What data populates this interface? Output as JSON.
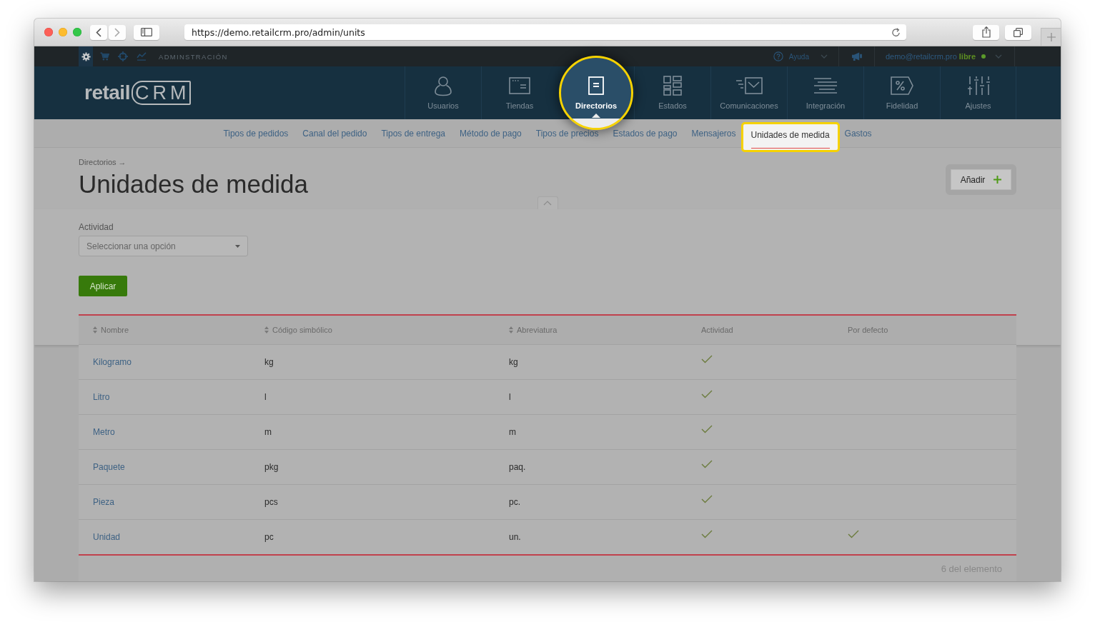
{
  "browser": {
    "url": "https://demo.retailcrm.pro/admin/units"
  },
  "admin_bar": {
    "tools": [
      {
        "selected": true
      },
      {
        "selected": false
      },
      {
        "selected": false
      },
      {
        "selected": false
      }
    ],
    "section": "ADMINSTRACIÓN",
    "help": "Ayuda",
    "user_email": "demo@retailcrm.pro",
    "plan": "libre"
  },
  "nav": {
    "logo": {
      "brand": "retail",
      "product": "CRM"
    },
    "items": [
      {
        "label": "Usuarios",
        "selected": false
      },
      {
        "label": "Tiendas",
        "selected": false
      },
      {
        "label": "Directorios",
        "selected": true
      },
      {
        "label": "Estados",
        "selected": false
      },
      {
        "label": "Comunicaciones",
        "selected": false
      },
      {
        "label": "Integración",
        "selected": false
      },
      {
        "label": "Fidelidad",
        "selected": false
      },
      {
        "label": "Ajustes",
        "selected": false
      }
    ]
  },
  "subnav": {
    "items": [
      {
        "label": "Tipos de pedidos",
        "selected": false
      },
      {
        "label": "Canal del pedido",
        "selected": false
      },
      {
        "label": "Tipos de entrega",
        "selected": false
      },
      {
        "label": "Método de pago",
        "selected": false
      },
      {
        "label": "Tipos de precios",
        "selected": false
      },
      {
        "label": "Estados de pago",
        "selected": false
      },
      {
        "label": "Mensajeros",
        "selected": false
      },
      {
        "label": "Unidades de medida",
        "selected": true
      },
      {
        "label": "Gastos",
        "selected": false
      }
    ]
  },
  "header": {
    "breadcrumb": {
      "label": "Directorios",
      "separator": "→"
    },
    "title": "Unidades de medida",
    "add_button": "Añadir"
  },
  "filter": {
    "label": "Actividad",
    "placeholder": "Seleccionar una opción",
    "apply_button": "Aplicar"
  },
  "table": {
    "columns": [
      {
        "label": "Nombre",
        "sortable": true
      },
      {
        "label": "Código simbólico",
        "sortable": true
      },
      {
        "label": "Abreviatura",
        "sortable": true
      },
      {
        "label": "Actividad",
        "sortable": false
      },
      {
        "label": "Por defecto",
        "sortable": false
      }
    ],
    "rows": [
      {
        "name": "Kilogramo",
        "code": "kg",
        "abbreviation": "kg",
        "active": true,
        "default": false
      },
      {
        "name": "Litro",
        "code": "l",
        "abbreviation": "l",
        "active": true,
        "default": false
      },
      {
        "name": "Metro",
        "code": "m",
        "abbreviation": "m",
        "active": true,
        "default": false
      },
      {
        "name": "Paquete",
        "code": "pkg",
        "abbreviation": "paq.",
        "active": true,
        "default": false
      },
      {
        "name": "Pieza",
        "code": "pcs",
        "abbreviation": "pc.",
        "active": true,
        "default": false
      },
      {
        "name": "Unidad",
        "code": "pc",
        "abbreviation": "un.",
        "active": true,
        "default": true
      }
    ],
    "footer": "6 del elemento"
  }
}
